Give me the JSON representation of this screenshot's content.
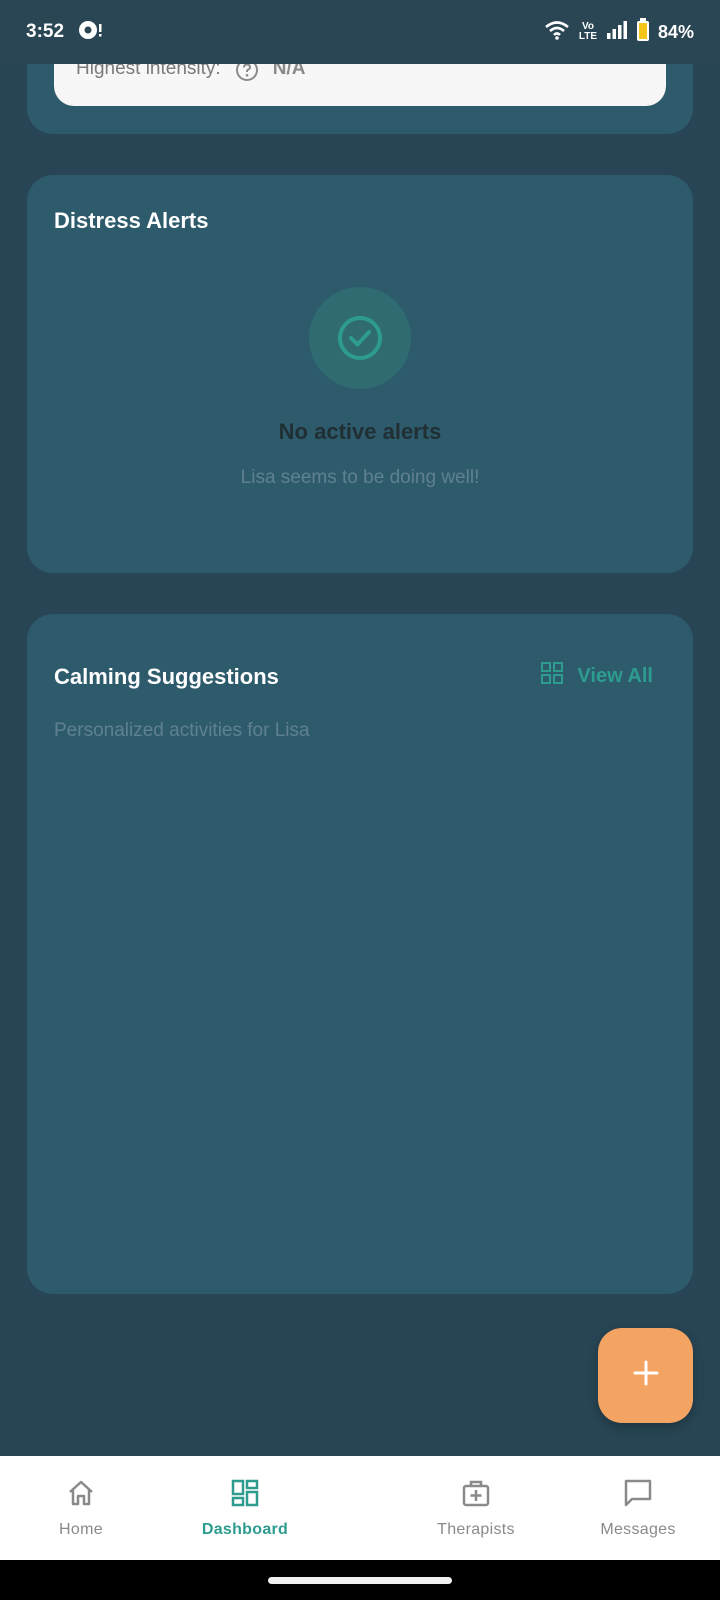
{
  "status_bar": {
    "time": "3:52",
    "battery": "84%",
    "network_label": "Vo LTE"
  },
  "summary_card": {
    "label": "Highest intensity:",
    "value": "N/A"
  },
  "alerts": {
    "title": "Distress Alerts",
    "heading": "No active alerts",
    "subtext": "Lisa seems to be doing well!"
  },
  "calming": {
    "title": "Calming Suggestions",
    "view_all": "View All",
    "subtext": "Personalized activities for Lisa"
  },
  "nav": {
    "home": "Home",
    "dashboard": "Dashboard",
    "therapists": "Therapists",
    "messages": "Messages"
  },
  "colors": {
    "background": "#274554",
    "card": "#2e5b6c",
    "accent": "#2d9c8f",
    "fab": "#f4a462"
  },
  "icons": {
    "fab": "plus-icon",
    "alerts": "check-circle-icon",
    "view_all": "grid-icon"
  }
}
